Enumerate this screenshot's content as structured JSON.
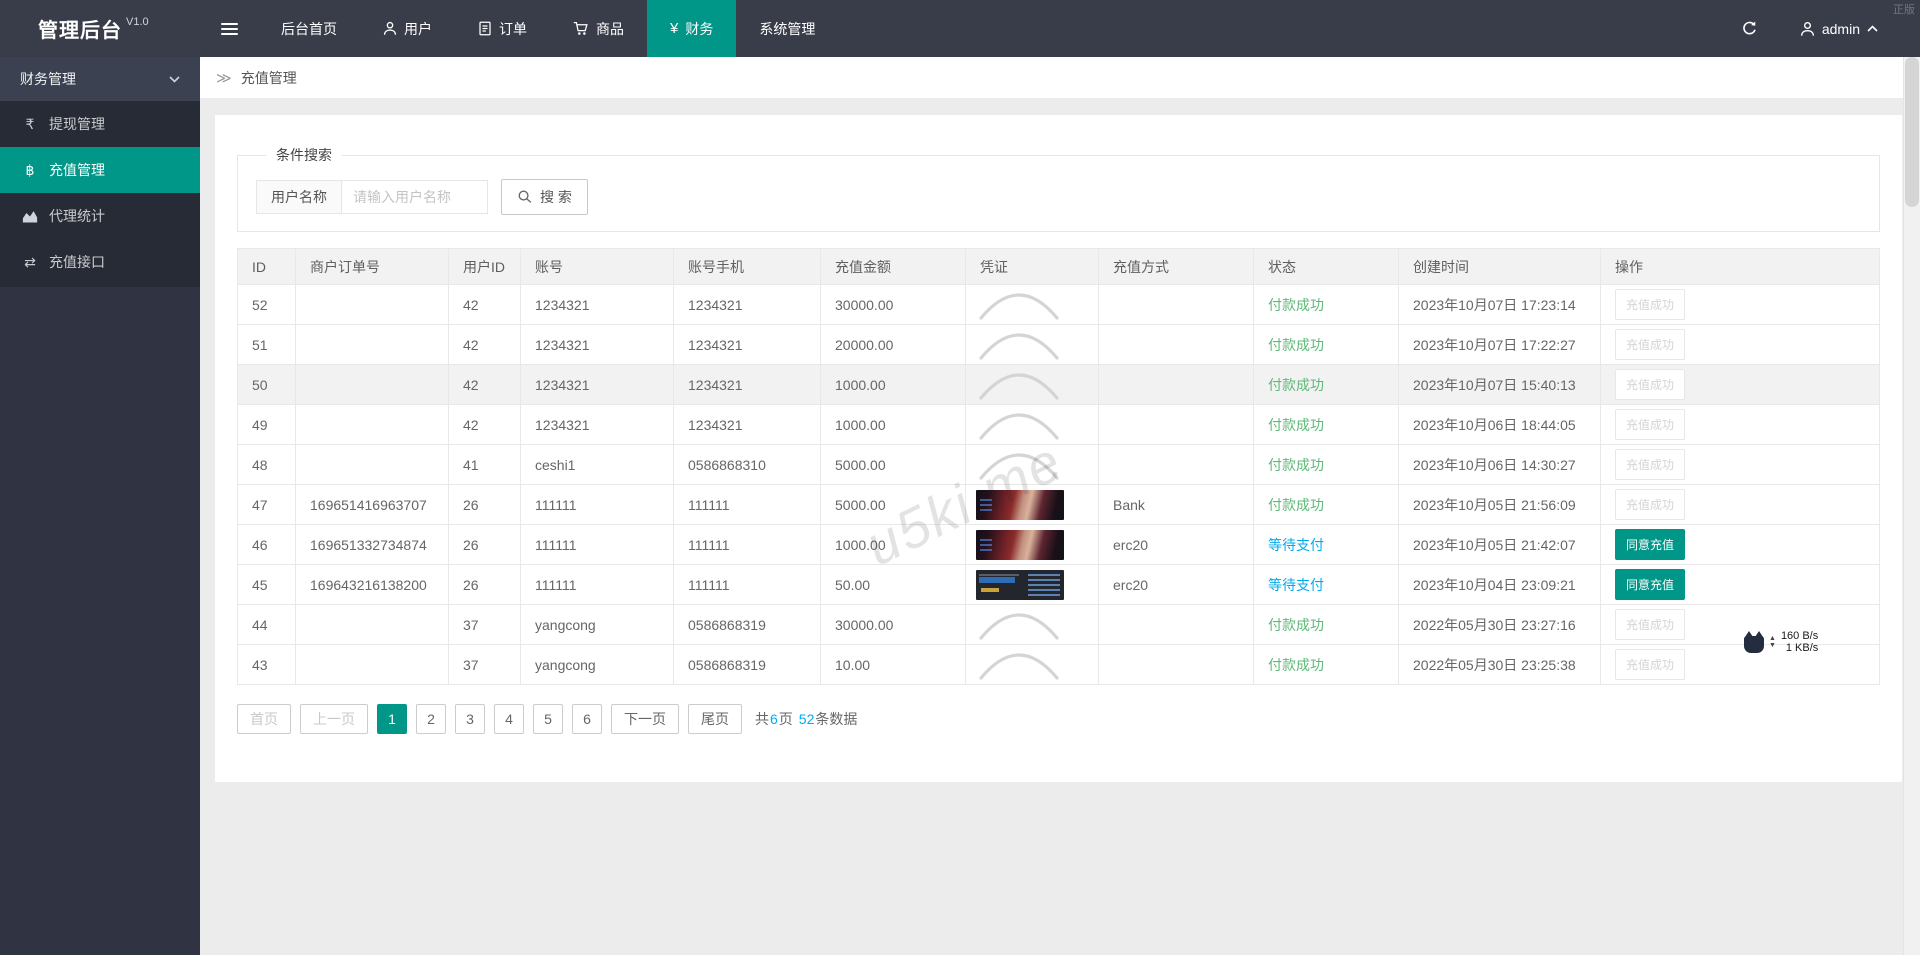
{
  "app": {
    "title": "管理后台",
    "version": "V1.0",
    "corner_watermark": "正版"
  },
  "topnav": {
    "items": [
      {
        "label": "后台首页",
        "icon": null,
        "active": false
      },
      {
        "label": "用户",
        "icon": "user",
        "active": false
      },
      {
        "label": "订单",
        "icon": "order",
        "active": false
      },
      {
        "label": "商品",
        "icon": "cart",
        "active": false
      },
      {
        "label": "财务",
        "icon": "yen",
        "active": true
      },
      {
        "label": "系统管理",
        "icon": null,
        "active": false
      }
    ],
    "user": "admin"
  },
  "sidebar": {
    "group": "财务管理",
    "items": [
      {
        "label": "提现管理",
        "icon": "withdraw",
        "active": false
      },
      {
        "label": "充值管理",
        "icon": "bitcoin",
        "active": true
      },
      {
        "label": "代理统计",
        "icon": "chart",
        "active": false
      },
      {
        "label": "充值接口",
        "icon": "exchange",
        "active": false
      }
    ]
  },
  "breadcrumb": {
    "separator": "≫",
    "title": "充值管理"
  },
  "search": {
    "legend": "条件搜索",
    "label": "用户名称",
    "placeholder": "请输入用户名称",
    "button": "搜 索"
  },
  "table": {
    "columns": [
      "ID",
      "商户订单号",
      "用户ID",
      "账号",
      "账号手机",
      "充值金额",
      "凭证",
      "充值方式",
      "状态",
      "创建时间",
      "操作"
    ],
    "rows": [
      {
        "id": "52",
        "order_no": "",
        "uid": "42",
        "account": "1234321",
        "phone": "1234321",
        "amount": "30000.00",
        "voucher": "arc",
        "method": "",
        "status": "付款成功",
        "status_state": "success",
        "created": "2023年10月07日 17:23:14",
        "action": "充值成功",
        "action_state": "disabled",
        "highlight": false
      },
      {
        "id": "51",
        "order_no": "",
        "uid": "42",
        "account": "1234321",
        "phone": "1234321",
        "amount": "20000.00",
        "voucher": "arc",
        "method": "",
        "status": "付款成功",
        "status_state": "success",
        "created": "2023年10月07日 17:22:27",
        "action": "充值成功",
        "action_state": "disabled",
        "highlight": false
      },
      {
        "id": "50",
        "order_no": "",
        "uid": "42",
        "account": "1234321",
        "phone": "1234321",
        "amount": "1000.00",
        "voucher": "arc",
        "method": "",
        "status": "付款成功",
        "status_state": "success",
        "created": "2023年10月07日 15:40:13",
        "action": "充值成功",
        "action_state": "disabled",
        "highlight": true
      },
      {
        "id": "49",
        "order_no": "",
        "uid": "42",
        "account": "1234321",
        "phone": "1234321",
        "amount": "1000.00",
        "voucher": "arc",
        "method": "",
        "status": "付款成功",
        "status_state": "success",
        "created": "2023年10月06日 18:44:05",
        "action": "充值成功",
        "action_state": "disabled",
        "highlight": false
      },
      {
        "id": "48",
        "order_no": "",
        "uid": "41",
        "account": "ceshi1",
        "phone": "0586868310",
        "amount": "5000.00",
        "voucher": "arc",
        "method": "",
        "status": "付款成功",
        "status_state": "success",
        "created": "2023年10月06日 14:30:27",
        "action": "充值成功",
        "action_state": "disabled",
        "highlight": false
      },
      {
        "id": "47",
        "order_no": "169651416963707",
        "uid": "26",
        "account": "111111",
        "phone": "111111",
        "amount": "5000.00",
        "voucher": "face",
        "method": "Bank",
        "status": "付款成功",
        "status_state": "success",
        "created": "2023年10月05日 21:56:09",
        "action": "充值成功",
        "action_state": "disabled",
        "highlight": false
      },
      {
        "id": "46",
        "order_no": "169651332734874",
        "uid": "26",
        "account": "111111",
        "phone": "111111",
        "amount": "1000.00",
        "voucher": "face",
        "method": "erc20",
        "status": "等待支付",
        "status_state": "waiting",
        "created": "2023年10月05日 21:42:07",
        "action": "同意充值",
        "action_state": "primary",
        "highlight": false
      },
      {
        "id": "45",
        "order_no": "169643216138200",
        "uid": "26",
        "account": "111111",
        "phone": "111111",
        "amount": "50.00",
        "voucher": "screen",
        "method": "erc20",
        "status": "等待支付",
        "status_state": "waiting",
        "created": "2023年10月04日 23:09:21",
        "action": "同意充值",
        "action_state": "primary",
        "highlight": false
      },
      {
        "id": "44",
        "order_no": "",
        "uid": "37",
        "account": "yangcong",
        "phone": "0586868319",
        "amount": "30000.00",
        "voucher": "arc",
        "method": "",
        "status": "付款成功",
        "status_state": "success",
        "created": "2022年05月30日 23:27:16",
        "action": "充值成功",
        "action_state": "disabled",
        "highlight": false
      },
      {
        "id": "43",
        "order_no": "",
        "uid": "37",
        "account": "yangcong",
        "phone": "0586868319",
        "amount": "10.00",
        "voucher": "arc",
        "method": "",
        "status": "付款成功",
        "status_state": "success",
        "created": "2022年05月30日 23:25:38",
        "action": "充值成功",
        "action_state": "disabled",
        "highlight": false
      }
    ]
  },
  "pagination": {
    "first": "首页",
    "prev": "上一页",
    "next": "下一页",
    "last": "尾页",
    "pages": [
      "1",
      "2",
      "3",
      "4",
      "5",
      "6"
    ],
    "active_page": "1",
    "summary": {
      "prefix": "共",
      "total_pages": "6",
      "pages_suffix": "页",
      "total_records": "52",
      "records_suffix": "条数据"
    }
  },
  "watermark": "u5ki.me",
  "net_monitor": {
    "upload": "160 B/s",
    "download": "1 KB/s"
  },
  "colors": {
    "accent": "#009688",
    "topbar": "#393D49",
    "sidebar": "#2F3342",
    "success": "#5FB878",
    "waiting": "#01AAED"
  }
}
